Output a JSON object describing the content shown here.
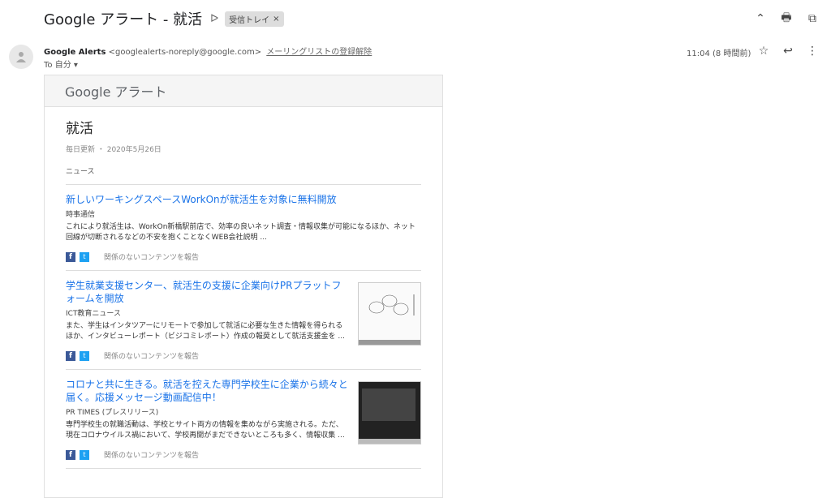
{
  "subject": "Google アラート - 就活",
  "label_chip": "受信トレイ",
  "sender_name": "Google Alerts",
  "sender_email": "<googlealerts-noreply@google.com>",
  "unsubscribe": "メーリングリストの登録解除",
  "to": "To 自分 ▾",
  "time": "11:04 (8 時間前)",
  "card_header": "Google アラート",
  "topic": "就活",
  "meta": "毎日更新 ・ 2020年5月26日",
  "section": "ニュース",
  "report_label": "関係のないコンテンツを報告",
  "items": [
    {
      "title": "新しいワーキングスペースWorkOnが就活生を対象に無料開放",
      "source": "時事通信",
      "desc": "これにより就活生は、WorkOn新橋駅前店で、効率の良いネット調査・情報収集が可能になるほか、ネット回線が切断されるなどの不安を抱くことなくWEB会社説明 ..."
    },
    {
      "title": "学生就業支援センター、就活生の支援に企業向けPRプラットフォームを開放",
      "source": "ICT教育ニュース",
      "desc": "また、学生はインタツアーにリモートで参加して就活に必要な生きた情報を得られるほか、インタビューレポート（ビジコミレポート）作成の報奨として就活支援金を ..."
    },
    {
      "title": "コロナと共に生きる。就活を控えた専門学校生に企業から続々と届く。応援メッセージ動画配信中！",
      "source": "PR TIMES (プレスリリース)",
      "desc": "専門学校生の就職活動は、学校とサイト両方の情報を集めながら実施される。ただ、現在コロナウイルス禍において、学校再開がまだできないところも多く、情報収集 ..."
    }
  ]
}
